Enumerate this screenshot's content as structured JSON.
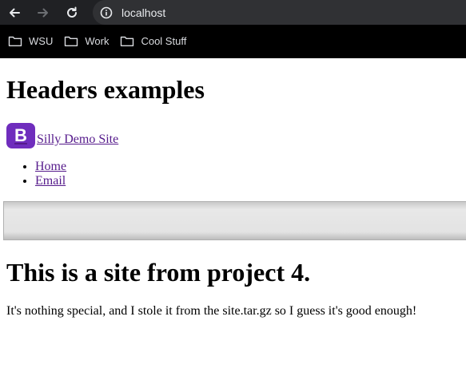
{
  "browser": {
    "url": "localhost",
    "icons": {
      "back": "arrow-left-icon",
      "forward": "arrow-right-icon",
      "reload": "reload-icon",
      "site_info": "info-icon"
    },
    "bookmarks": [
      {
        "label": "WSU",
        "icon": "folder-icon"
      },
      {
        "label": "Work",
        "icon": "folder-icon"
      },
      {
        "label": "Cool Stuff",
        "icon": "folder-icon"
      }
    ]
  },
  "page": {
    "title": "Headers examples",
    "brand": {
      "logo_letter": "B",
      "label": "Silly Demo Site",
      "logo_color": "#6f2dbd"
    },
    "nav": [
      {
        "label": "Home"
      },
      {
        "label": "Email"
      }
    ],
    "heading": "This is a site from project 4.",
    "description": "It's nothing special, and I stole it from the site.tar.gz so I guess it's good enough!"
  }
}
